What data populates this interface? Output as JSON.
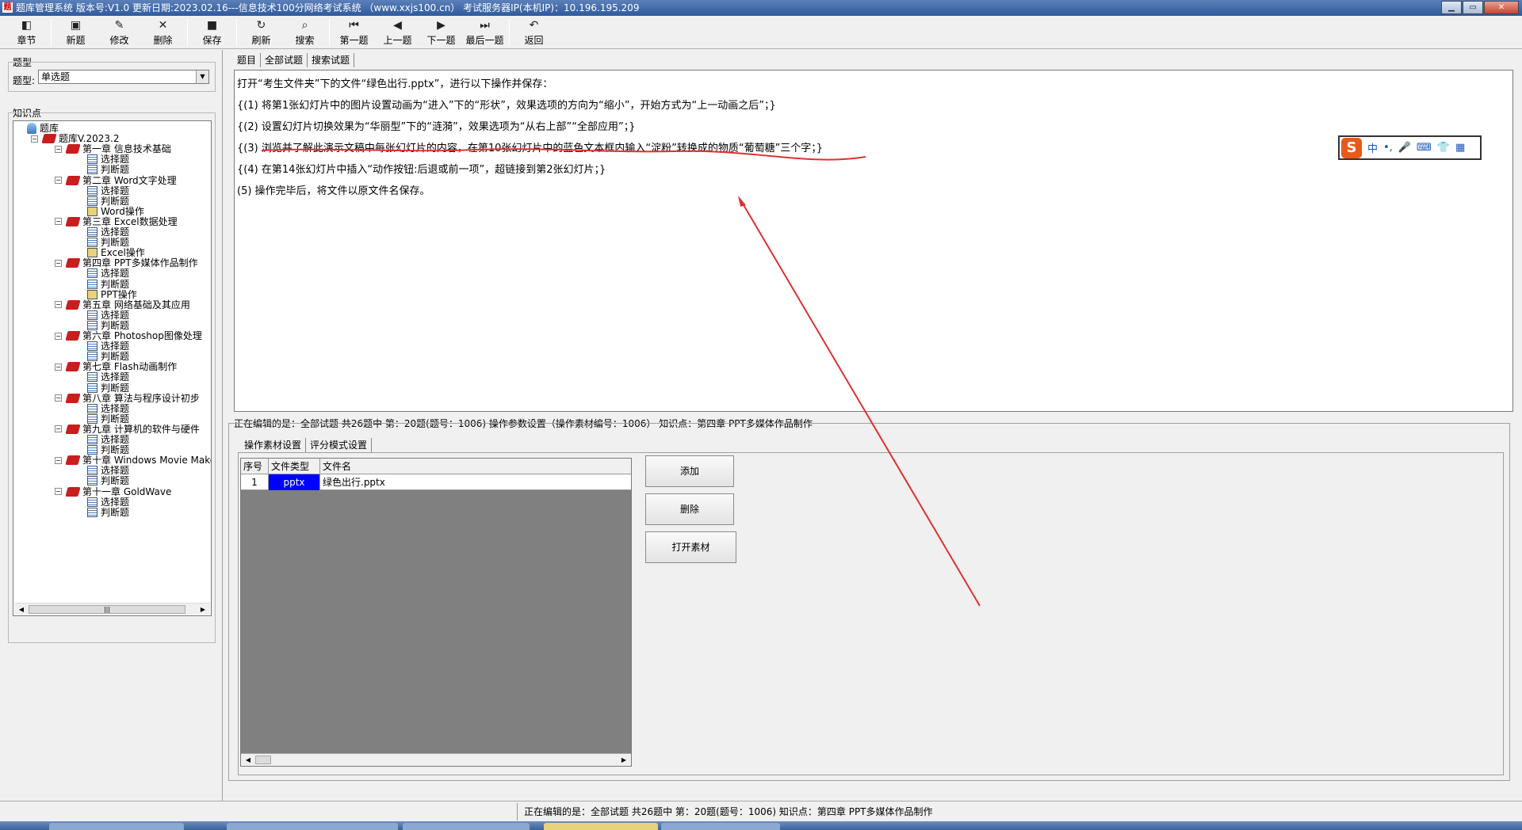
{
  "window": {
    "title": "题库管理系统 版本号:V1.0 更新日期:2023.02.16---信息技术100分网络考试系统 （www.xxjs100.cn） 考试服务器IP(本机IP)：10.196.195.209",
    "app_icon": "题"
  },
  "toolbar": [
    {
      "label": "章节",
      "icon": "chapter-icon",
      "glyph": "◧"
    },
    {
      "label": "新题",
      "icon": "new-icon",
      "glyph": "▣"
    },
    {
      "label": "修改",
      "icon": "edit-icon",
      "glyph": "✎"
    },
    {
      "label": "删除",
      "icon": "delete-icon",
      "glyph": "✕"
    },
    {
      "label": "保存",
      "icon": "save-icon",
      "glyph": "■"
    },
    {
      "label": "刷新",
      "icon": "refresh-icon",
      "glyph": "↻"
    },
    {
      "label": "搜索",
      "icon": "search-icon",
      "glyph": "⌕"
    },
    {
      "label": "第一题",
      "icon": "first-icon",
      "glyph": "⏮"
    },
    {
      "label": "上一题",
      "icon": "prev-icon",
      "glyph": "◀"
    },
    {
      "label": "下一题",
      "icon": "next-icon",
      "glyph": "▶"
    },
    {
      "label": "最后一题",
      "icon": "last-icon",
      "glyph": "⏭"
    },
    {
      "label": "返回",
      "icon": "back-icon",
      "glyph": "↶"
    }
  ],
  "left": {
    "type_group": "题型",
    "type_label": "题型:",
    "type_value": "单选题",
    "kp_group": "知识点",
    "tree": [
      {
        "label": "题库",
        "level": 0,
        "icon": "root"
      },
      {
        "label": "题库V.2023.2",
        "level": 1,
        "icon": "book",
        "tog": "−"
      },
      {
        "label": "第一章 信息技术基础",
        "level": 2,
        "icon": "book",
        "tog": "−"
      },
      {
        "label": "选择题",
        "level": 3,
        "icon": "list"
      },
      {
        "label": "判断题",
        "level": 3,
        "icon": "list"
      },
      {
        "label": "第二章 Word文字处理",
        "level": 2,
        "icon": "book",
        "tog": "−"
      },
      {
        "label": "选择题",
        "level": 3,
        "icon": "list"
      },
      {
        "label": "判断题",
        "level": 3,
        "icon": "list"
      },
      {
        "label": "Word操作",
        "level": 3,
        "icon": "op"
      },
      {
        "label": "第三章 Excel数据处理",
        "level": 2,
        "icon": "book",
        "tog": "−"
      },
      {
        "label": "选择题",
        "level": 3,
        "icon": "list"
      },
      {
        "label": "判断题",
        "level": 3,
        "icon": "list"
      },
      {
        "label": "Excel操作",
        "level": 3,
        "icon": "op"
      },
      {
        "label": "第四章 PPT多媒体作品制作",
        "level": 2,
        "icon": "book",
        "tog": "−"
      },
      {
        "label": "选择题",
        "level": 3,
        "icon": "list"
      },
      {
        "label": "判断题",
        "level": 3,
        "icon": "list"
      },
      {
        "label": "PPT操作",
        "level": 3,
        "icon": "op"
      },
      {
        "label": "第五章 网络基础及其应用",
        "level": 2,
        "icon": "book",
        "tog": "−"
      },
      {
        "label": "选择题",
        "level": 3,
        "icon": "list"
      },
      {
        "label": "判断题",
        "level": 3,
        "icon": "list"
      },
      {
        "label": "第六章 Photoshop图像处理",
        "level": 2,
        "icon": "book",
        "tog": "−"
      },
      {
        "label": "选择题",
        "level": 3,
        "icon": "list"
      },
      {
        "label": "判断题",
        "level": 3,
        "icon": "list"
      },
      {
        "label": "第七章 Flash动画制作",
        "level": 2,
        "icon": "book",
        "tog": "−"
      },
      {
        "label": "选择题",
        "level": 3,
        "icon": "list"
      },
      {
        "label": "判断题",
        "level": 3,
        "icon": "list"
      },
      {
        "label": "第八章 算法与程序设计初步",
        "level": 2,
        "icon": "book",
        "tog": "−"
      },
      {
        "label": "选择题",
        "level": 3,
        "icon": "list"
      },
      {
        "label": "判断题",
        "level": 3,
        "icon": "list"
      },
      {
        "label": "第九章 计算机的软件与硬件",
        "level": 2,
        "icon": "book",
        "tog": "−"
      },
      {
        "label": "选择题",
        "level": 3,
        "icon": "list"
      },
      {
        "label": "判断题",
        "level": 3,
        "icon": "list"
      },
      {
        "label": "第十章 Windows Movie Make",
        "level": 2,
        "icon": "book",
        "tog": "−"
      },
      {
        "label": "选择题",
        "level": 3,
        "icon": "list"
      },
      {
        "label": "判断题",
        "level": 3,
        "icon": "list"
      },
      {
        "label": "第十一章 GoldWave",
        "level": 2,
        "icon": "book",
        "tog": "−"
      },
      {
        "label": "选择题",
        "level": 3,
        "icon": "list"
      },
      {
        "label": "判断题",
        "level": 3,
        "icon": "list"
      }
    ]
  },
  "main_tabs": [
    "题目",
    "全部试题",
    "搜索试题"
  ],
  "question": [
    "打开“考生文件夹”下的文件“绿色出行.pptx”，进行以下操作并保存：",
    "{(1) 将第1张幻灯片中的图片设置动画为“进入”下的“形状”，效果选项的方向为“缩小”，开始方式为“上一动画之后”；}",
    "{(2) 设置幻灯片切换效果为“华丽型”下的“涟漪”，效果选项为“从右上部”“全部应用”；}",
    "{(3) 浏览并了解此演示文稿中每张幻灯片的内容，在第10张幻灯片中的蓝色文本框内输入“淀粉”转换成的物质“葡萄糖”三个字；}",
    "{(4) 在第14张幻灯片中插入“动作按钮:后退或前一项”，超链接到第2张幻灯片；}",
    "(5) 操作完毕后，将文件以原文件名保存。"
  ],
  "editing_info": "正在编辑的是：全部试题 共26题中   第：20题(题号：1006) 操作参数设置（操作素材编号：1006） 知识点：第四章 PPT多媒体作品制作",
  "sub_tabs": [
    "操作素材设置",
    "评分模式设置"
  ],
  "grid": {
    "headers": [
      "序号",
      "文件类型",
      "文件名"
    ],
    "rows": [
      {
        "no": "1",
        "type": "pptx",
        "name": "绿色出行.pptx"
      }
    ]
  },
  "buttons": {
    "add": "添加",
    "delete": "删除",
    "open": "打开素材"
  },
  "status": "正在编辑的是：全部试题 共26题中   第：20题(题号：1006)  知识点：第四章 PPT多媒体作品制作",
  "ime": {
    "logo": "S",
    "items": [
      "中",
      "•,",
      "🎤",
      "⌨",
      "👕",
      "▦"
    ]
  },
  "colors": {
    "annotation": "#e03030",
    "filetype_bg": "#0000ff",
    "grid_bg": "#808080"
  }
}
